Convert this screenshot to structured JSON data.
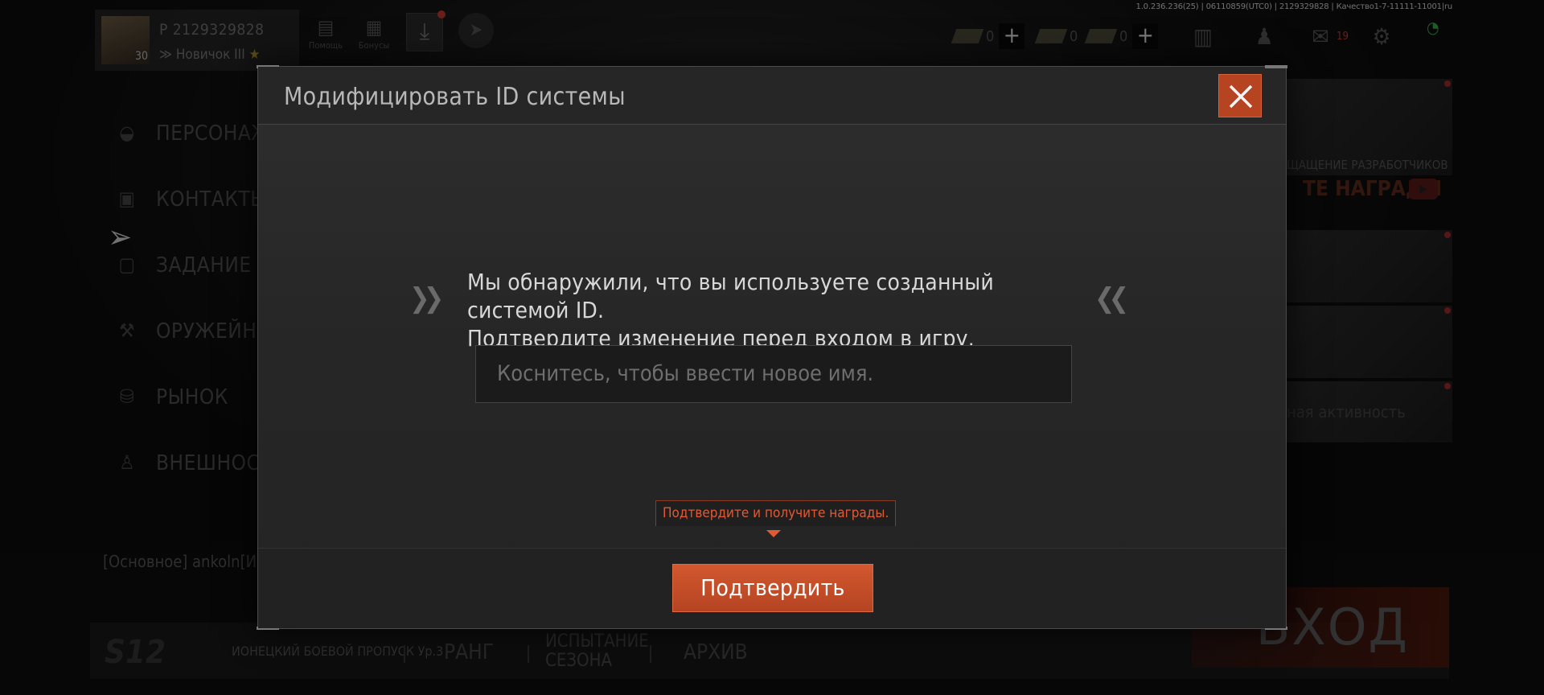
{
  "build_info": "1.0.236.236(25) | 06110859(UTC0) | 2129329828 | Качество1-7-11111-11001|ru",
  "profile": {
    "id": "P 2129329828",
    "level": "30",
    "rank": "Новичок III"
  },
  "top_buttons": [
    {
      "label": "Помощь"
    },
    {
      "label": "Бонусы"
    }
  ],
  "currencies": [
    {
      "value": "0"
    },
    {
      "value": "0"
    },
    {
      "value": "0"
    }
  ],
  "mail_count": "19",
  "left_menu": [
    {
      "label": "ПЕРСОНАЖ"
    },
    {
      "label": "КОНТАКТЫ"
    },
    {
      "label": "ЗАДАНИЕ"
    },
    {
      "label": "ОРУЖЕЙНИК"
    },
    {
      "label": "РЫНОК"
    },
    {
      "label": "ВНЕШНОСТЬ"
    }
  ],
  "footer_note": "[Основное] ankoln[И",
  "right_banners": {
    "dev_note": "ЩАЩЕНИЕ РАЗРАБОТЧИКОВ",
    "rewards": "ТЕ НАГРАДЫ",
    "activity": "ная активность"
  },
  "bottom_bar": {
    "season": "S12",
    "battle_pass": "ИОНЕЦКИЙ БОЕВОЙ ПРОПУСК Ур.3",
    "tabs": [
      "РАНГ",
      "ИСПЫТАНИЕ\nСЕЗОНА",
      "АРХИВ"
    ],
    "enter": "ВХОД"
  },
  "modal": {
    "title": "Модифицировать ID системы",
    "message_line1": "Мы обнаружили, что вы используете созданный системой ID.",
    "message_line2": "Подтвердите изменение перед входом в игру.",
    "input_placeholder": "Коснитесь, чтобы ввести новое имя.",
    "hint": "Подтвердите и получите награды.",
    "confirm_label": "Подтвердить",
    "accent_color": "#c44e28"
  }
}
